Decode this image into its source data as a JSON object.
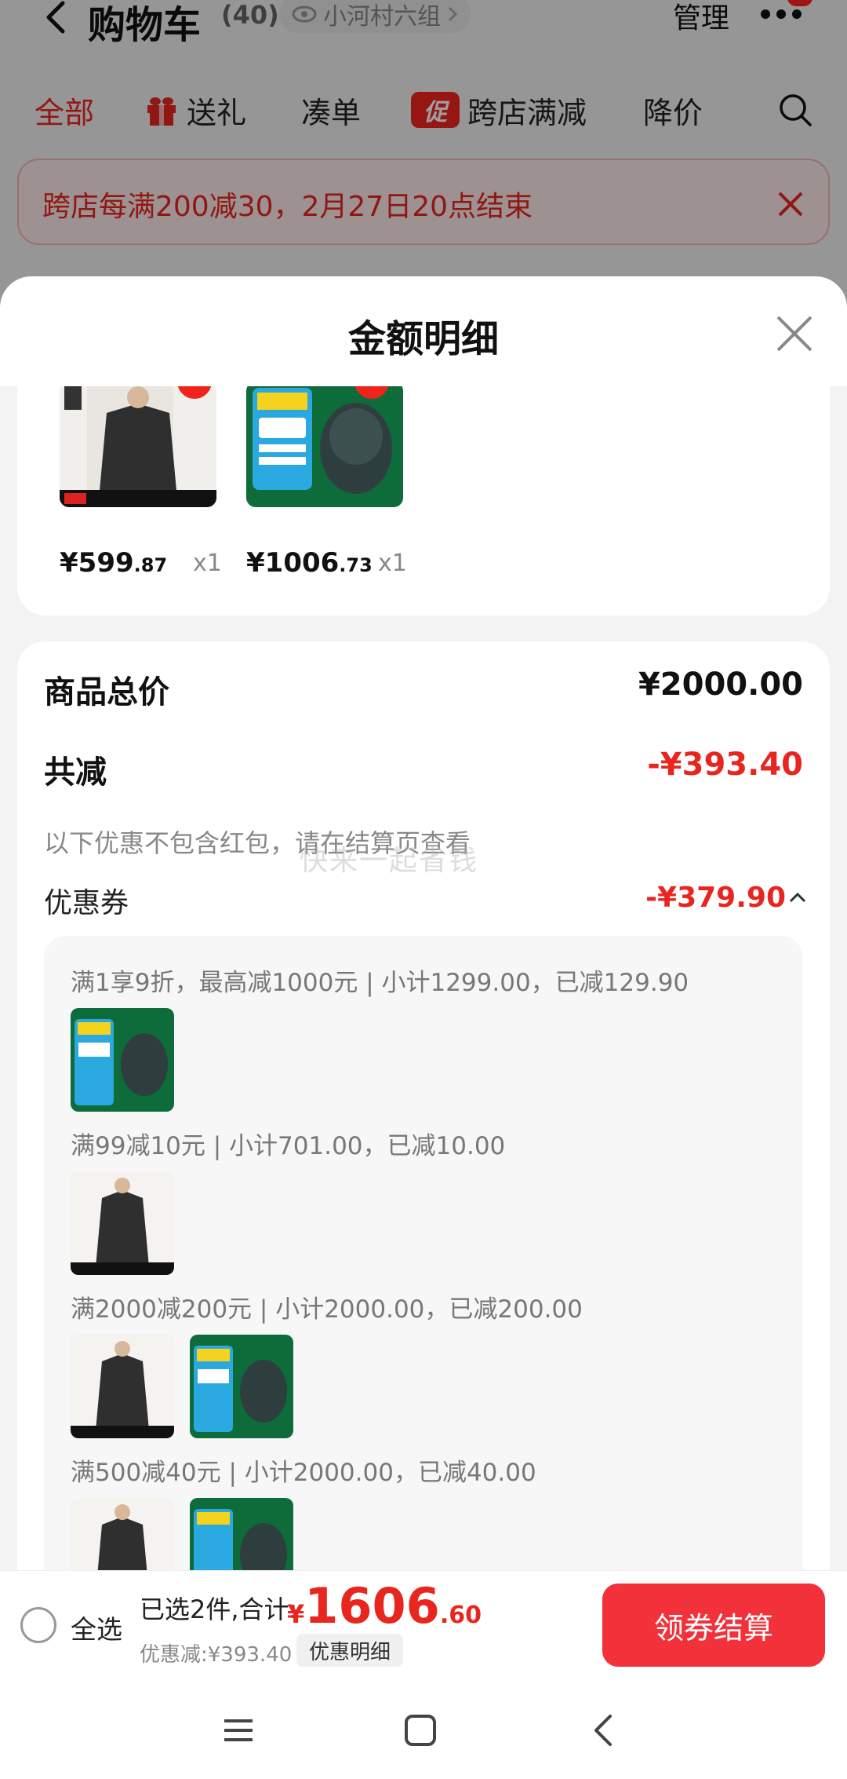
{
  "header": {
    "title": "购物车",
    "count": "(40)",
    "location": "小河村六组",
    "manage": "管理"
  },
  "tabs": [
    {
      "label": "全部"
    },
    {
      "label": "送礼"
    },
    {
      "label": "凑单"
    },
    {
      "label": "跨店满减",
      "badge": "促"
    },
    {
      "label": "降价"
    }
  ],
  "promo_banner": {
    "text": "跨店每满200减30，2月27日20点结束"
  },
  "sheet": {
    "title": "金额明细"
  },
  "products": [
    {
      "name": "coat",
      "price_int": "¥599",
      "price_dec": ".87",
      "qty": "x1"
    },
    {
      "name": "mouse",
      "price_int": "¥1006",
      "price_dec": ".73",
      "qty": "x1"
    }
  ],
  "summary": {
    "total_label": "商品总价",
    "total_value": "¥2000.00",
    "discount_label": "共减",
    "discount_value": "-¥393.40",
    "note": "以下优惠不包含红包，请在结算页查看",
    "watermark": "快来一起省钱",
    "coupon_label": "优惠券",
    "coupon_value": "-¥379.90"
  },
  "coupon_lines": [
    "满1享9折，最高减1000元 | 小计1299.00，已减129.90",
    "满99减10元 | 小计701.00，已减10.00",
    "满2000减200元 | 小计2000.00，已减200.00",
    "满500减40元 | 小计2000.00，已减40.00"
  ],
  "checkout": {
    "select_all": "全选",
    "selected": "已选2件,合计:",
    "currency": "¥",
    "total_int": "1606",
    "total_dec": ".60",
    "saved": "优惠减:¥393.40",
    "detail_chip": "优惠明细",
    "button": "领券结算"
  },
  "colors": {
    "accent_red": "#e8261f",
    "button_red": "#f2313a",
    "promo_bg": "#fdeceb"
  }
}
